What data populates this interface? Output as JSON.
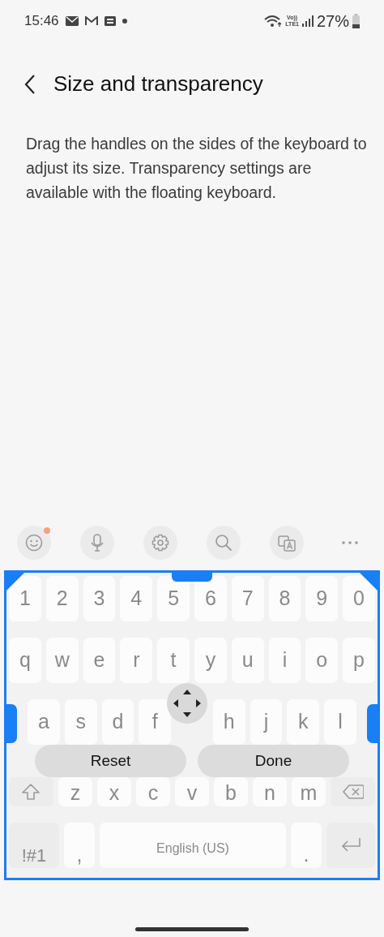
{
  "status_bar": {
    "time": "15:46",
    "network_label": [
      "Vo))",
      "LTE1"
    ],
    "battery": "27%"
  },
  "header": {
    "title": "Size and transparency"
  },
  "description": "Drag the handles on the sides of the keyboard to adjust its size. Transparency settings are available with the floating keyboard.",
  "toolbar": [
    {
      "kind": "emoji",
      "badge": true
    },
    {
      "kind": "mic",
      "badge": false
    },
    {
      "kind": "settings",
      "badge": false
    },
    {
      "kind": "search",
      "badge": false
    },
    {
      "kind": "translate",
      "badge": false
    },
    {
      "kind": "more",
      "badge": false
    }
  ],
  "keyboard": {
    "rows": [
      {
        "keys": [
          {
            "kind": "char",
            "text": "1"
          },
          {
            "kind": "char",
            "text": "2"
          },
          {
            "kind": "char",
            "text": "3"
          },
          {
            "kind": "char",
            "text": "4"
          },
          {
            "kind": "char",
            "text": "5"
          },
          {
            "kind": "char",
            "text": "6"
          },
          {
            "kind": "char",
            "text": "7"
          },
          {
            "kind": "char",
            "text": "8"
          },
          {
            "kind": "char",
            "text": "9"
          },
          {
            "kind": "char",
            "text": "0"
          }
        ]
      },
      {
        "keys": [
          {
            "kind": "char",
            "text": "q"
          },
          {
            "kind": "char",
            "text": "w"
          },
          {
            "kind": "char",
            "text": "e"
          },
          {
            "kind": "char",
            "text": "r"
          },
          {
            "kind": "char",
            "text": "t"
          },
          {
            "kind": "char",
            "text": "y"
          },
          {
            "kind": "char",
            "text": "u"
          },
          {
            "kind": "char",
            "text": "i"
          },
          {
            "kind": "char",
            "text": "o"
          },
          {
            "kind": "char",
            "text": "p"
          }
        ]
      },
      {
        "keys": [
          {
            "kind": "char",
            "text": "a"
          },
          {
            "kind": "char",
            "text": "s"
          },
          {
            "kind": "char",
            "text": "d"
          },
          {
            "kind": "char",
            "text": "f"
          },
          {
            "kind": "hidden"
          },
          {
            "kind": "char",
            "text": "h"
          },
          {
            "kind": "char",
            "text": "j"
          },
          {
            "kind": "char",
            "text": "k"
          },
          {
            "kind": "char",
            "text": "l"
          }
        ]
      },
      {
        "keys": [
          {
            "kind": "shift"
          },
          {
            "kind": "char",
            "text": "z"
          },
          {
            "kind": "char",
            "text": "x"
          },
          {
            "kind": "char",
            "text": "c"
          },
          {
            "kind": "char",
            "text": "v"
          },
          {
            "kind": "char",
            "text": "b"
          },
          {
            "kind": "char",
            "text": "n"
          },
          {
            "kind": "char",
            "text": "m"
          },
          {
            "kind": "backspace"
          }
        ]
      },
      {
        "keys": [
          {
            "kind": "symbols",
            "text": "!#1"
          },
          {
            "kind": "comma",
            "text": ","
          },
          {
            "kind": "space",
            "text": "English (US)"
          },
          {
            "kind": "period",
            "text": "."
          },
          {
            "kind": "enter"
          }
        ]
      }
    ],
    "overlay_buttons": [
      "Reset",
      "Done"
    ]
  }
}
